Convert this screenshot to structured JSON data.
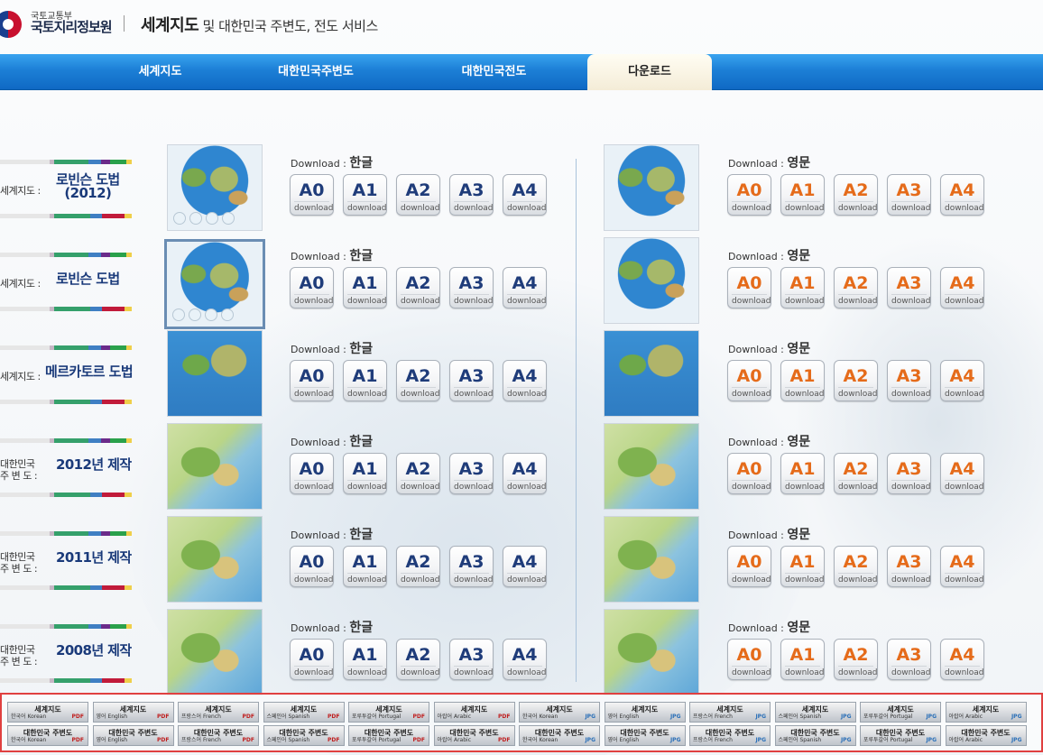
{
  "header": {
    "org_small": "국토교통부",
    "org": "국토지리정보원",
    "service_bold": "세계지도",
    "service_rest": " 및 대한민국 주변도, 전도 서비스"
  },
  "nav": {
    "items": [
      {
        "label": "세계지도"
      },
      {
        "label": "대한민국주변도"
      },
      {
        "label": "대한민국전도"
      },
      {
        "label": "다운로드",
        "active": true
      }
    ]
  },
  "download_title_prefix": "Download",
  "lang_ko": "한글",
  "lang_en": "영문",
  "button_sub": "download",
  "sizes": [
    "A0",
    "A1",
    "A2",
    "A3",
    "A4"
  ],
  "rows": [
    {
      "pre": "세계지도 :",
      "main": "로빈슨 도법\n(2012)"
    },
    {
      "pre": "세계지도 :",
      "main": "로빈슨 도법"
    },
    {
      "pre": "세계지도 :",
      "main": "메르카토르 도법"
    },
    {
      "pre": "대한민국\n주 변 도 :",
      "main": "2012년 제작"
    },
    {
      "pre": "대한민국\n주 변 도 :",
      "main": "2011년 제작"
    },
    {
      "pre": "대한민국\n주 변 도 :",
      "main": "2008년 제작"
    }
  ],
  "footer": {
    "row1_title": "세계지도",
    "row2_title": "대한민국 주변도",
    "langs": [
      "한국어 Korean",
      "영어 English",
      "프랑스어 French",
      "스페인어 Spanish",
      "포루투갈어 Portugal",
      "아랍어 Arabic"
    ],
    "pdf": "PDF",
    "jpg": "JPG"
  }
}
